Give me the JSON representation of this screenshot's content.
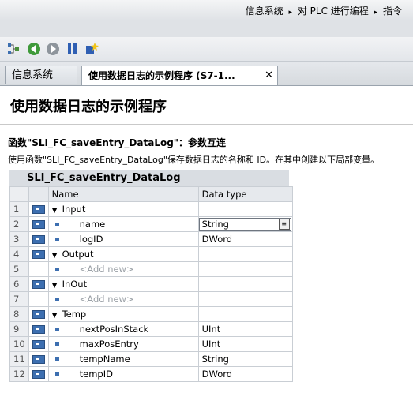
{
  "breadcrumb": {
    "items": [
      "信息系统",
      "对 PLC 进行编程",
      "指令"
    ],
    "separator": "▸"
  },
  "toolbar": {
    "icons": [
      "hierarchy-icon",
      "back-icon",
      "forward-icon",
      "bookmark-icon",
      "favorite-add-icon"
    ]
  },
  "tabs": [
    {
      "label": "信息系统"
    },
    {
      "label": "使用数据日志的示例程序 (S7-1...",
      "close": "✕"
    }
  ],
  "page": {
    "title": "使用数据日志的示例程序",
    "subhead": "函数\"SLI_FC_saveEntry_DataLog\"：参数互连",
    "desc": "使用函数\"SLI_FC_saveEntry_DataLog\"保存数据日志的名称和 ID。在其中创建以下局部变量。"
  },
  "block": {
    "name": "SLI_FC_saveEntry_DataLog",
    "columns": {
      "name": "Name",
      "type": "Data type"
    },
    "rows": [
      {
        "n": "1",
        "name": "Input",
        "type": "",
        "kind": "section"
      },
      {
        "n": "2",
        "name": "name",
        "type": "String",
        "kind": "var"
      },
      {
        "n": "3",
        "name": "logID",
        "type": "DWord",
        "kind": "var"
      },
      {
        "n": "4",
        "name": "Output",
        "type": "",
        "kind": "section"
      },
      {
        "n": "5",
        "name": "<Add new>",
        "type": "",
        "kind": "add"
      },
      {
        "n": "6",
        "name": "InOut",
        "type": "",
        "kind": "section"
      },
      {
        "n": "7",
        "name": "<Add new>",
        "type": "",
        "kind": "add"
      },
      {
        "n": "8",
        "name": "Temp",
        "type": "",
        "kind": "section"
      },
      {
        "n": "9",
        "name": "nextPosInStack",
        "type": "UInt",
        "kind": "var"
      },
      {
        "n": "10",
        "name": "maxPosEntry",
        "type": "UInt",
        "kind": "var"
      },
      {
        "n": "11",
        "name": "tempName",
        "type": "String",
        "kind": "var"
      },
      {
        "n": "12",
        "name": "tempID",
        "type": "DWord",
        "kind": "var"
      }
    ]
  },
  "colors": {
    "accent": "#3d6fb0",
    "header_bg": "#d9dde2"
  }
}
